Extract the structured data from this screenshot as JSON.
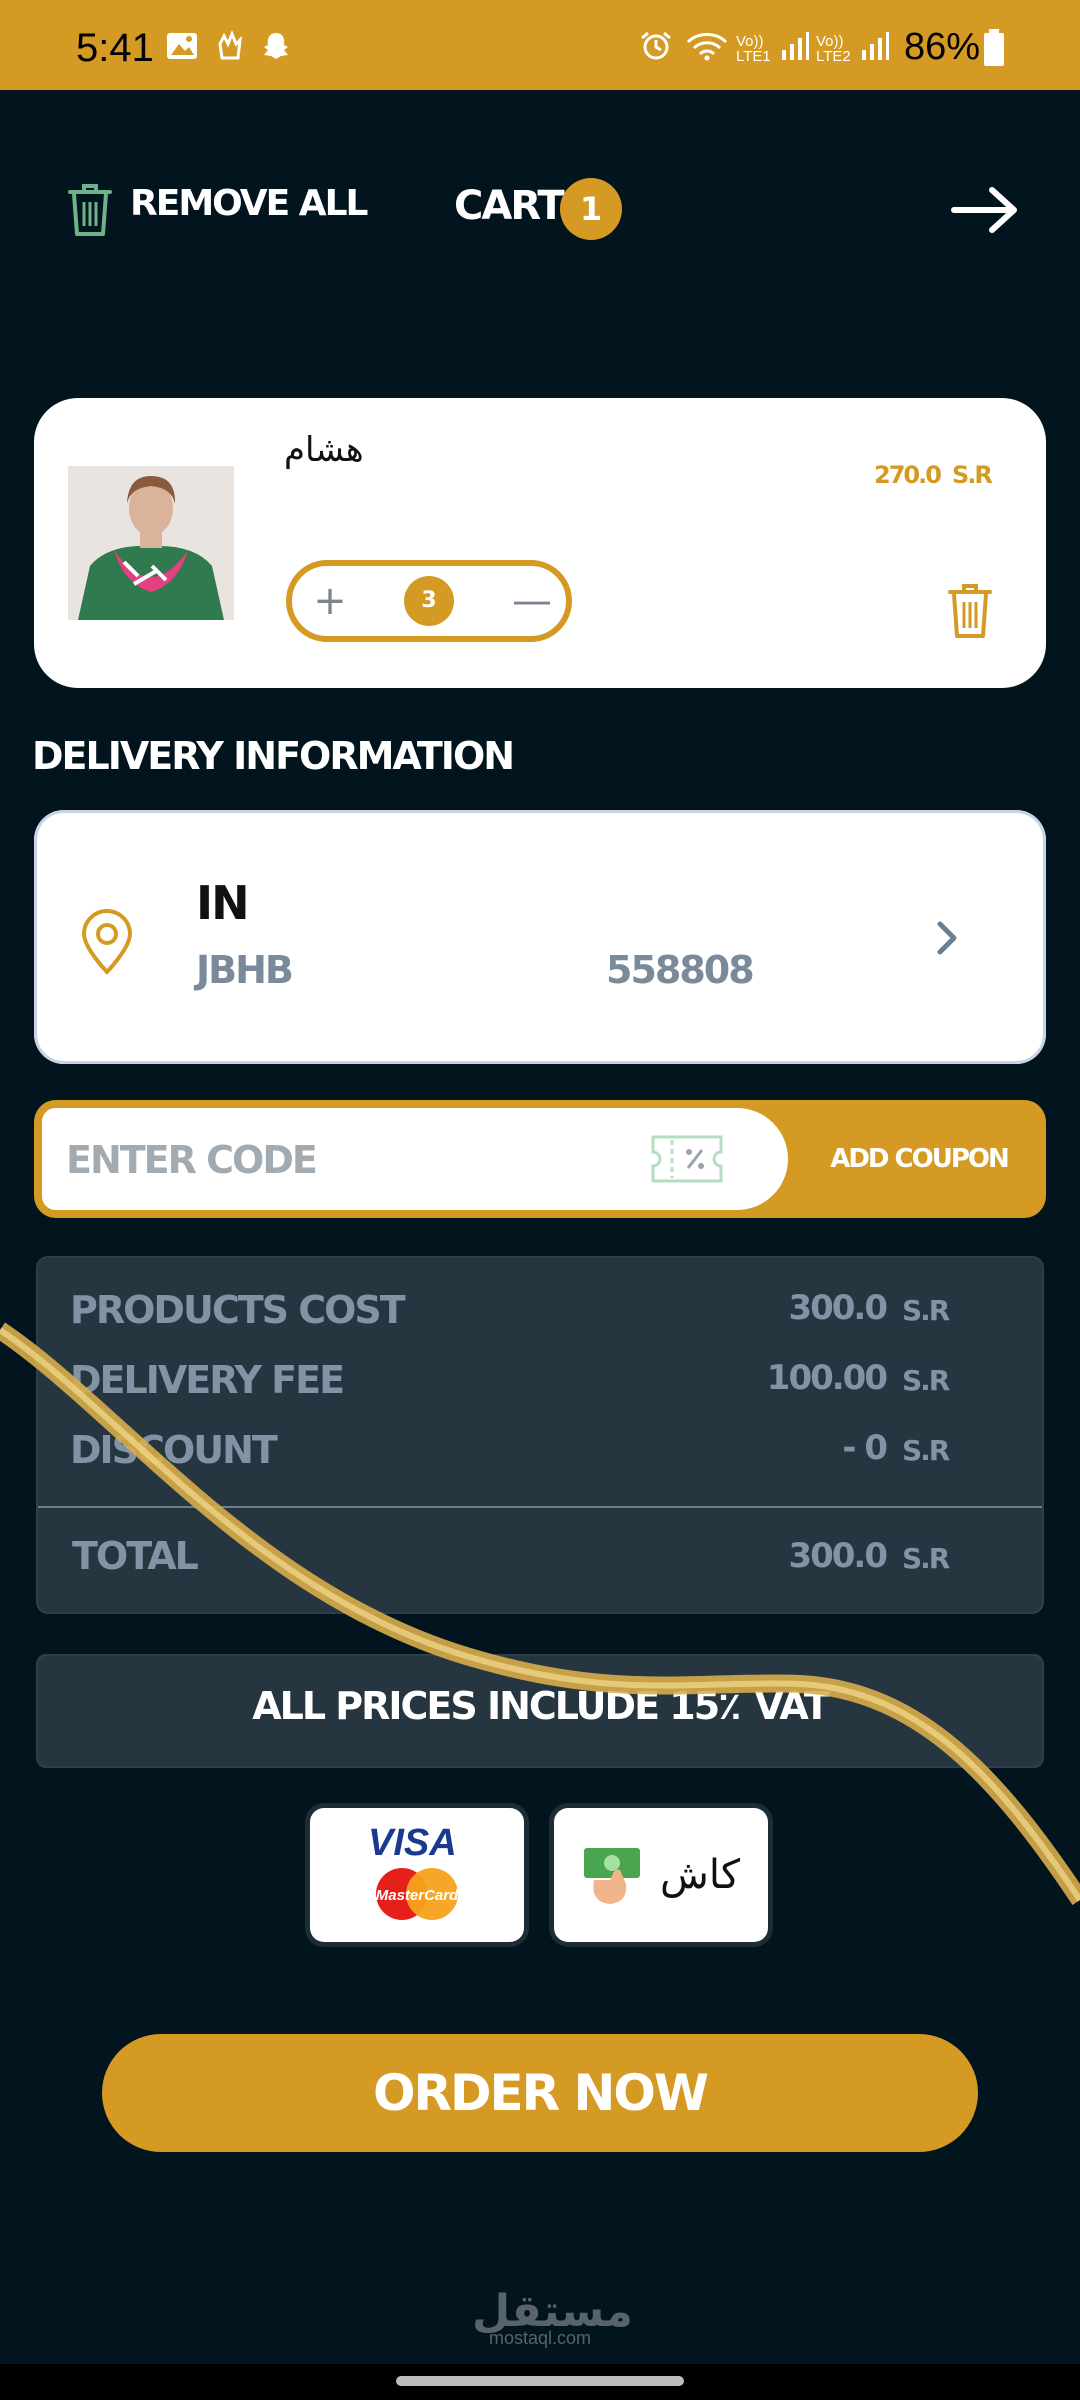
{
  "status_bar": {
    "time": "5:41",
    "battery": "86%",
    "icons": [
      "image-icon",
      "hand-icon",
      "snapchat-icon",
      "alarm-icon",
      "wifi-icon",
      "signal-lte1-icon",
      "signal-lte2-icon",
      "battery-icon"
    ],
    "lte1": "Vo)) LTE1",
    "lte2": "Vo)) LTE2"
  },
  "header": {
    "remove_all_label": "REMOVE ALL",
    "cart_title": "CART",
    "cart_count": "1"
  },
  "product": {
    "name": "هشام",
    "price": "270.0",
    "currency": "S.R",
    "quantity": "3",
    "plus_symbol": "+",
    "minus_symbol": "—"
  },
  "delivery": {
    "title": "DELIVERY INFORMATION",
    "country": "IN",
    "city": "JBHB",
    "code": "558808"
  },
  "coupon": {
    "placeholder": "ENTER CODE",
    "button_label": "ADD COUPON"
  },
  "summary": {
    "rows": [
      {
        "label": "PRODUCTS COST",
        "value": "300.0",
        "currency": "S.R"
      },
      {
        "label": "DELIVERY FEE",
        "value": "100.00",
        "currency": "S.R"
      },
      {
        "label": "DISCOUNT",
        "value": "- 0",
        "currency": "S.R"
      }
    ],
    "total": {
      "label": "TOTAL",
      "value": "300.0",
      "currency": "S.R"
    }
  },
  "vat_notice": "ALL PRICES INCLUDE 15٪ VAT",
  "payment": {
    "card_brand_visa": "VISA",
    "card_brand_mastercard": "MasterCard",
    "cash_label": "كاش"
  },
  "order_button_label": "ORDER NOW",
  "watermark": {
    "logo": "مستقل",
    "url": "mostaql.com"
  },
  "colors": {
    "accent": "#d49a24",
    "background": "#02151f",
    "panel": "#263640",
    "muted_text": "#8094a6"
  }
}
